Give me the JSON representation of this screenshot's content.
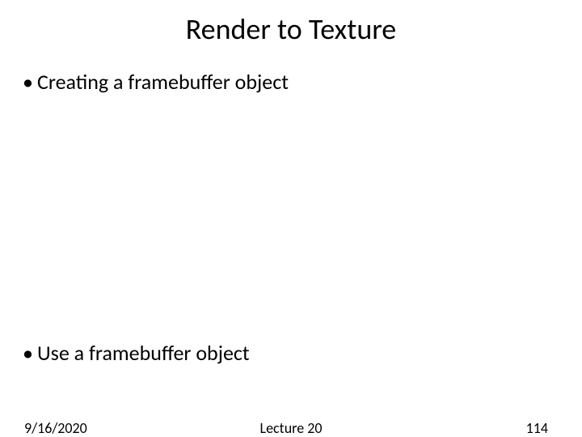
{
  "slide": {
    "title": "Render to Texture",
    "bullets": [
      "Creating a framebuffer object",
      "Use a framebuffer object"
    ],
    "footer": {
      "date": "9/16/2020",
      "center": "Lecture 20",
      "page": "114"
    }
  }
}
